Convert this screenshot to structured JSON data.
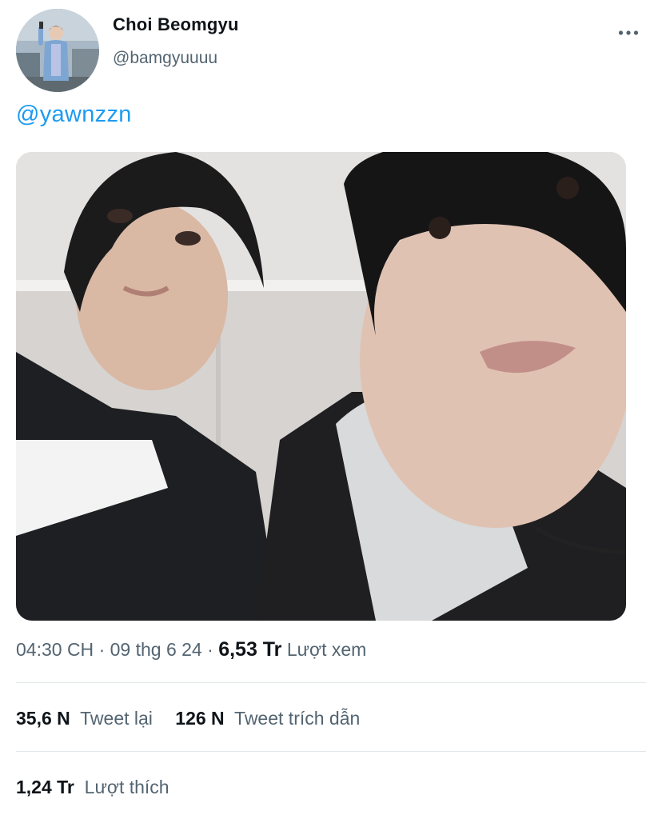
{
  "user": {
    "display_name": "Choi Beomgyu",
    "handle": "@bamgyuuuu"
  },
  "tweet": {
    "text_mention": "@yawnzzn"
  },
  "meta": {
    "time": "04:30 CH",
    "separator": "·",
    "date": "09 thg 6 24",
    "views_count": "6,53 Tr",
    "views_label": "Lượt xem"
  },
  "stats": {
    "retweets_count": "35,6 N",
    "retweets_label": "Tweet lại",
    "quotes_count": "126 N",
    "quotes_label": "Tweet trích dẫn",
    "likes_count": "1,24 Tr",
    "likes_label": "Lượt thích"
  },
  "icons": {
    "more": "more-horizontal-icon"
  },
  "colors": {
    "link": "#1d9bf0",
    "secondary_text": "#536471",
    "primary_text": "#0f1419",
    "divider": "#e1e6ea"
  }
}
